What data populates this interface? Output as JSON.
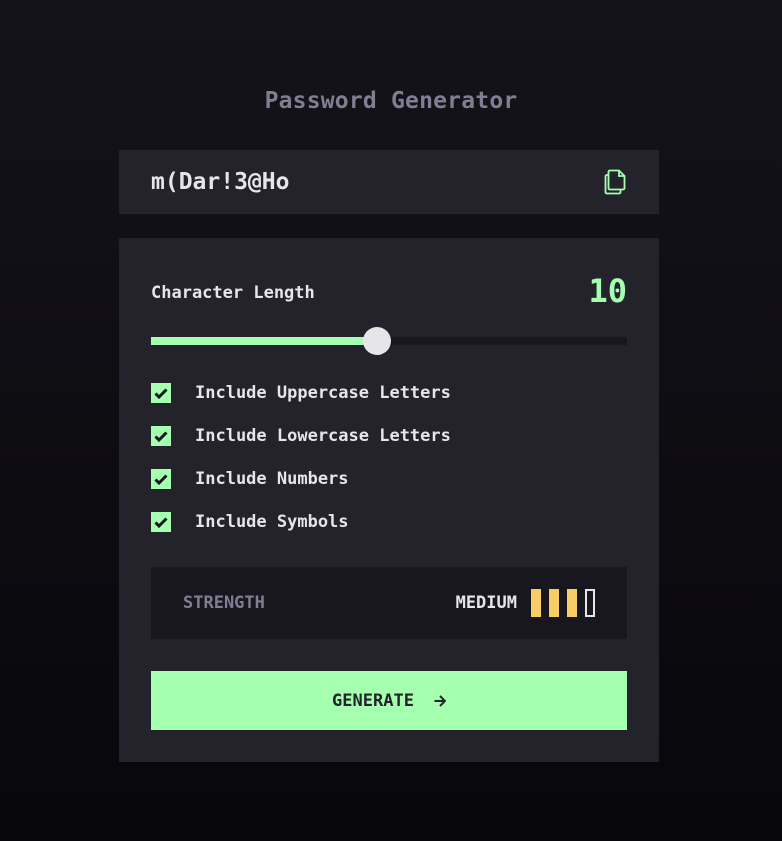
{
  "app": {
    "title": "Password Generator"
  },
  "output": {
    "password": "m(Dar!3@Ho",
    "copy_icon": "copy-icon"
  },
  "length": {
    "label": "Character Length",
    "value": "10",
    "fraction": 0.475
  },
  "options": [
    {
      "label": "Include Uppercase Letters",
      "checked": true
    },
    {
      "label": "Include Lowercase Letters",
      "checked": true
    },
    {
      "label": "Include Numbers",
      "checked": true
    },
    {
      "label": "Include Symbols",
      "checked": true
    }
  ],
  "strength": {
    "label": "STRENGTH",
    "level": "MEDIUM",
    "filled_bars": 3,
    "total_bars": 4
  },
  "generate": {
    "label": "GENERATE",
    "icon": "arrow-right-icon"
  },
  "colors": {
    "accent": "#a4ffaf",
    "strength_medium": "#f8cd65",
    "panel": "#24232c",
    "muted": "#817d92"
  }
}
